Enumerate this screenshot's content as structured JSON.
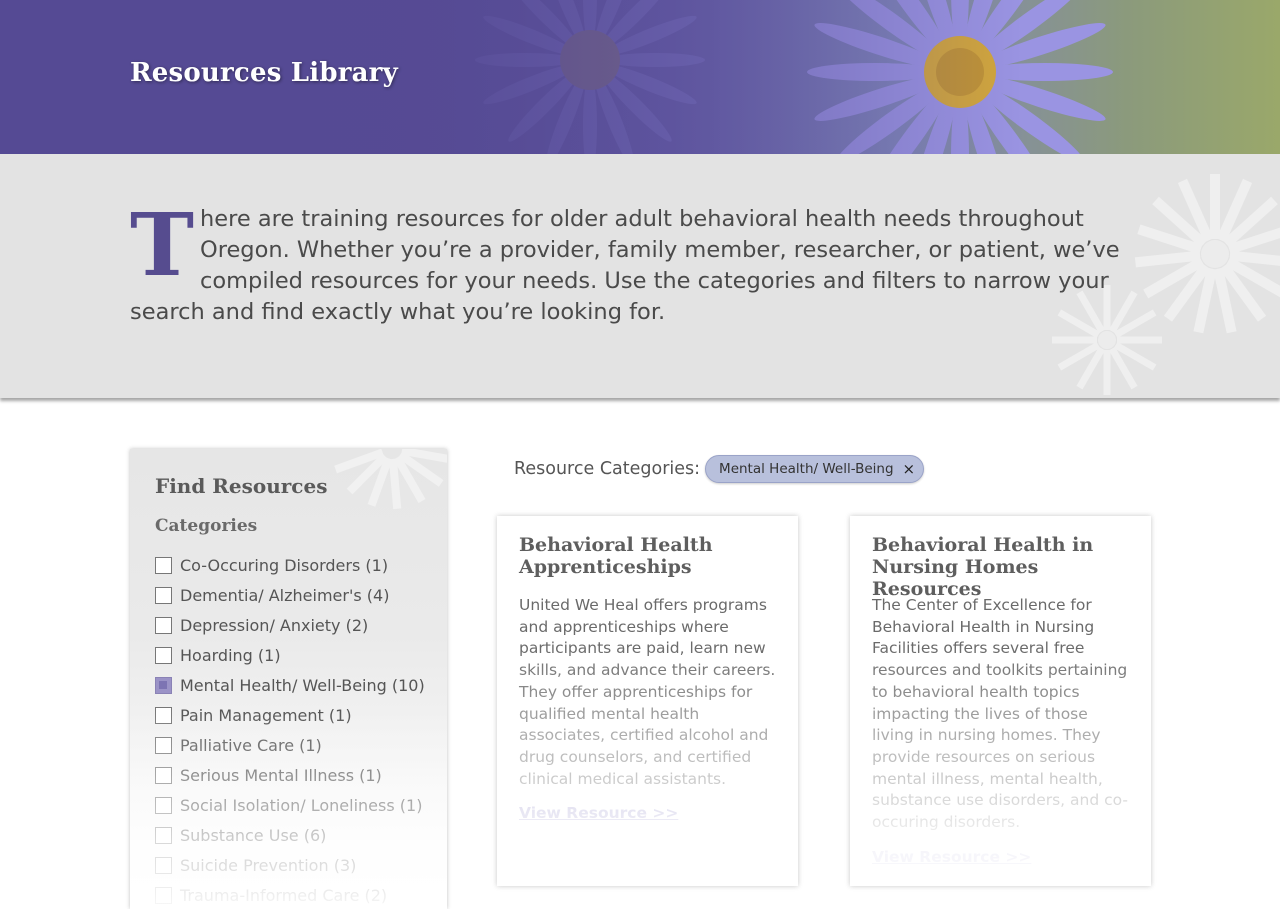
{
  "header": {
    "title": "Resources Library"
  },
  "intro": {
    "dropcap": "T",
    "text": "here are training resources for older adult behavioral health needs throughout Oregon. Whether you’re a provider, family member, researcher, or patient, we’ve compiled resources for your needs. Use the categories and filters to narrow your search and find exactly what you’re looking for."
  },
  "sidebar": {
    "title": "Find Resources",
    "categories_heading": "Categories",
    "categories": [
      {
        "label": "Co-Occuring Disorders (1)",
        "checked": false
      },
      {
        "label": "Dementia/ Alzheimer's (4)",
        "checked": false
      },
      {
        "label": "Depression/ Anxiety (2)",
        "checked": false
      },
      {
        "label": "Hoarding (1)",
        "checked": false
      },
      {
        "label": "Mental Health/ Well-Being (10)",
        "checked": true
      },
      {
        "label": "Pain Management (1)",
        "checked": false
      },
      {
        "label": "Palliative Care (1)",
        "checked": false
      },
      {
        "label": "Serious Mental Illness (1)",
        "checked": false
      },
      {
        "label": "Social Isolation/ Loneliness (1)",
        "checked": false
      },
      {
        "label": "Substance Use (6)",
        "checked": false
      },
      {
        "label": "Suicide Prevention (3)",
        "checked": false
      },
      {
        "label": "Trauma-Informed Care (2)",
        "checked": false
      }
    ]
  },
  "filters": {
    "label": "Resource Categories:",
    "active_chip": "Mental Health/ Well-Being",
    "chip_close": "×"
  },
  "cards": [
    {
      "title": "Behavioral Health Apprenticeships",
      "description": "United We Heal offers programs and apprenticeships where participants are paid, learn new skills, and advance their careers. They offer apprenticeships for qualified mental health associates, certified alcohol and drug counselors, and certified clinical medical assistants.",
      "link": "View Resource >>"
    },
    {
      "title": "Behavioral Health in Nursing Homes Resources",
      "description": "The Center of Excellence for Behavioral Health in Nursing Facilities offers several free resources and toolkits pertaining to behavioral health topics impacting the lives of those living in nursing homes. They provide resources on serious mental illness, mental health, substance use disorders, and co-occuring disorders.",
      "link": "View Resource >>"
    }
  ],
  "colors": {
    "brand_purple": "#564c8f",
    "chip_bg": "#b8c0dc",
    "link": "#8f88c6",
    "checked_box": "#9b93c7"
  }
}
